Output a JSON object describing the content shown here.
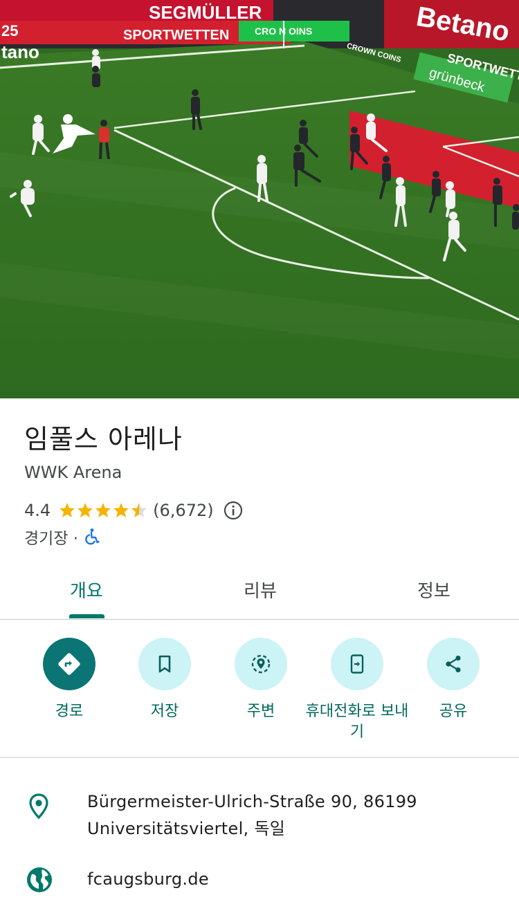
{
  "place": {
    "name": "임풀스 아레나",
    "alt_name": "WWK Arena",
    "rating": "4.4",
    "rating_value": 4.4,
    "review_count": "(6,672)",
    "category": "경기장 ·"
  },
  "photo": {
    "ad_boards": [
      "SEGMÜLLER",
      "SPORTWETTEN",
      "CRO  N  OINS",
      "Betano",
      "SPORTWETTEN",
      "grünbeck",
      "CROWN COINS",
      "tano",
      "25"
    ]
  },
  "tabs": [
    {
      "label": "개요",
      "active": true
    },
    {
      "label": "리뷰",
      "active": false
    },
    {
      "label": "정보",
      "active": false
    }
  ],
  "actions": [
    {
      "label": "경로",
      "icon": "directions-icon"
    },
    {
      "label": "저장",
      "icon": "bookmark-icon"
    },
    {
      "label": "주변",
      "icon": "nearby-icon"
    },
    {
      "label": "휴대전화로 보내기",
      "icon": "send-to-phone-icon"
    },
    {
      "label": "공유",
      "icon": "share-icon"
    }
  ],
  "info": {
    "address_line1": "Bürgermeister-Ulrich-Straße 90, 86199",
    "address_line2": "Universitätsviertel, 독일",
    "website": "fcaugsburg.de"
  },
  "colors": {
    "accent": "#00796b",
    "primary_button": "#0a7574",
    "tonal_button": "#ccf3f5",
    "star": "#f5b400"
  }
}
